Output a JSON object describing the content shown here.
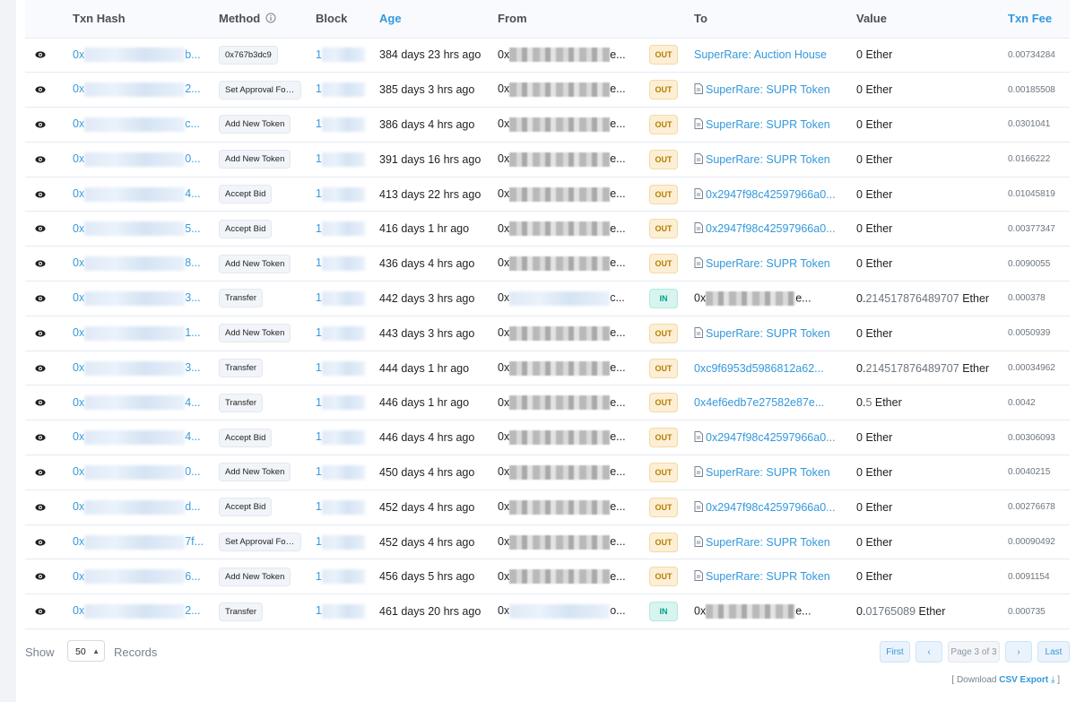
{
  "columns": {
    "eye": "",
    "txn_hash": "Txn Hash",
    "method": "Method",
    "block": "Block",
    "age": "Age",
    "from": "From",
    "dir": "",
    "to": "To",
    "value": "Value",
    "fee": "Txn Fee"
  },
  "rows": [
    {
      "hash_pre": "0x",
      "hash_tail": "b...",
      "method": "0x767b3dc9",
      "block_pre": "1",
      "age": "384 days 23 hrs ago",
      "from_pre": "0x",
      "from_tail": "e...",
      "direction": "OUT",
      "to": "SuperRare: Auction House",
      "to_contract": false,
      "to_link": true,
      "value_int": "0",
      "value_dec": "",
      "value_unit": "Ether",
      "fee": "0.00734284"
    },
    {
      "hash_pre": "0x",
      "hash_tail": "2...",
      "method": "Set Approval For...",
      "block_pre": "1",
      "age": "385 days 3 hrs ago",
      "from_pre": "0x",
      "from_tail": "e...",
      "direction": "OUT",
      "to": "SuperRare: SUPR Token",
      "to_contract": true,
      "to_link": true,
      "value_int": "0",
      "value_dec": "",
      "value_unit": "Ether",
      "fee": "0.00185508"
    },
    {
      "hash_pre": "0x",
      "hash_tail": "c...",
      "method": "Add New Token",
      "block_pre": "1",
      "age": "386 days 4 hrs ago",
      "from_pre": "0x",
      "from_tail": "e...",
      "direction": "OUT",
      "to": "SuperRare: SUPR Token",
      "to_contract": true,
      "to_link": true,
      "value_int": "0",
      "value_dec": "",
      "value_unit": "Ether",
      "fee": "0.0301041"
    },
    {
      "hash_pre": "0x",
      "hash_tail": "0...",
      "method": "Add New Token",
      "block_pre": "1",
      "age": "391 days 16 hrs ago",
      "from_pre": "0x",
      "from_tail": "e...",
      "direction": "OUT",
      "to": "SuperRare: SUPR Token",
      "to_contract": true,
      "to_link": true,
      "value_int": "0",
      "value_dec": "",
      "value_unit": "Ether",
      "fee": "0.0166222"
    },
    {
      "hash_pre": "0x",
      "hash_tail": "4...",
      "method": "Accept Bid",
      "block_pre": "1",
      "age": "413 days 22 hrs ago",
      "from_pre": "0x",
      "from_tail": "e...",
      "direction": "OUT",
      "to": "0x2947f98c42597966a0...",
      "to_contract": true,
      "to_link": true,
      "value_int": "0",
      "value_dec": "",
      "value_unit": "Ether",
      "fee": "0.01045819"
    },
    {
      "hash_pre": "0x",
      "hash_tail": "5...",
      "method": "Accept Bid",
      "block_pre": "1",
      "age": "416 days 1 hr ago",
      "from_pre": "0x",
      "from_tail": "e...",
      "direction": "OUT",
      "to": "0x2947f98c42597966a0...",
      "to_contract": true,
      "to_link": true,
      "value_int": "0",
      "value_dec": "",
      "value_unit": "Ether",
      "fee": "0.00377347"
    },
    {
      "hash_pre": "0x",
      "hash_tail": "8...",
      "method": "Add New Token",
      "block_pre": "1",
      "age": "436 days 4 hrs ago",
      "from_pre": "0x",
      "from_tail": "e...",
      "direction": "OUT",
      "to": "SuperRare: SUPR Token",
      "to_contract": true,
      "to_link": true,
      "value_int": "0",
      "value_dec": "",
      "value_unit": "Ether",
      "fee": "0.0090055"
    },
    {
      "hash_pre": "0x",
      "hash_tail": "3...",
      "method": "Transfer",
      "block_pre": "1",
      "age": "442 days 3 hrs ago",
      "from_pre": "0x",
      "from_tail": "c...",
      "from_link": true,
      "direction": "IN",
      "to": "0x",
      "to_tail": "e...",
      "to_contract": false,
      "to_link": false,
      "value_int": "0.",
      "value_dec": "214517876489707",
      "value_unit": "Ether",
      "fee": "0.000378"
    },
    {
      "hash_pre": "0x",
      "hash_tail": "1...",
      "method": "Add New Token",
      "block_pre": "1",
      "age": "443 days 3 hrs ago",
      "from_pre": "0x",
      "from_tail": "e...",
      "direction": "OUT",
      "to": "SuperRare: SUPR Token",
      "to_contract": true,
      "to_link": true,
      "value_int": "0",
      "value_dec": "",
      "value_unit": "Ether",
      "fee": "0.0050939"
    },
    {
      "hash_pre": "0x",
      "hash_tail": "3...",
      "method": "Transfer",
      "block_pre": "1",
      "age": "444 days 1 hr ago",
      "from_pre": "0x",
      "from_tail": "e...",
      "direction": "OUT",
      "to": "0xc9f6953d5986812a62...",
      "to_contract": false,
      "to_link": true,
      "value_int": "0.",
      "value_dec": "214517876489707",
      "value_unit": "Ether",
      "fee": "0.00034962"
    },
    {
      "hash_pre": "0x",
      "hash_tail": "4...",
      "method": "Transfer",
      "block_pre": "1",
      "age": "446 days 1 hr ago",
      "from_pre": "0x",
      "from_tail": "e...",
      "direction": "OUT",
      "to": "0x4ef6edb7e27582e87e...",
      "to_contract": false,
      "to_link": true,
      "value_int": "0.",
      "value_dec": "5",
      "value_unit": "Ether",
      "fee": "0.0042"
    },
    {
      "hash_pre": "0x",
      "hash_tail": "4...",
      "method": "Accept Bid",
      "block_pre": "1",
      "age": "446 days 4 hrs ago",
      "from_pre": "0x",
      "from_tail": "e...",
      "direction": "OUT",
      "to": "0x2947f98c42597966a0...",
      "to_contract": true,
      "to_link": true,
      "value_int": "0",
      "value_dec": "",
      "value_unit": "Ether",
      "fee": "0.00306093"
    },
    {
      "hash_pre": "0x",
      "hash_tail": "0...",
      "method": "Add New Token",
      "block_pre": "1",
      "age": "450 days 4 hrs ago",
      "from_pre": "0x",
      "from_tail": "e...",
      "direction": "OUT",
      "to": "SuperRare: SUPR Token",
      "to_contract": true,
      "to_link": true,
      "value_int": "0",
      "value_dec": "",
      "value_unit": "Ether",
      "fee": "0.0040215"
    },
    {
      "hash_pre": "0x",
      "hash_tail": "d...",
      "method": "Accept Bid",
      "block_pre": "1",
      "age": "452 days 4 hrs ago",
      "from_pre": "0x",
      "from_tail": "e...",
      "direction": "OUT",
      "to": "0x2947f98c42597966a0...",
      "to_contract": true,
      "to_link": true,
      "value_int": "0",
      "value_dec": "",
      "value_unit": "Ether",
      "fee": "0.00276678"
    },
    {
      "hash_pre": "0x",
      "hash_tail": "7f...",
      "method": "Set Approval For...",
      "block_pre": "1",
      "age": "452 days 4 hrs ago",
      "from_pre": "0x",
      "from_tail": "e...",
      "direction": "OUT",
      "to": "SuperRare: SUPR Token",
      "to_contract": true,
      "to_link": true,
      "value_int": "0",
      "value_dec": "",
      "value_unit": "Ether",
      "fee": "0.00090492"
    },
    {
      "hash_pre": "0x",
      "hash_tail": "6...",
      "method": "Add New Token",
      "block_pre": "1",
      "age": "456 days 5 hrs ago",
      "from_pre": "0x",
      "from_tail": "e...",
      "direction": "OUT",
      "to": "SuperRare: SUPR Token",
      "to_contract": true,
      "to_link": true,
      "value_int": "0",
      "value_dec": "",
      "value_unit": "Ether",
      "fee": "0.0091154"
    },
    {
      "hash_pre": "0x",
      "hash_tail": "2...",
      "method": "Transfer",
      "block_pre": "1",
      "age": "461 days 20 hrs ago",
      "from_pre": "0x",
      "from_tail": "o...",
      "from_link": true,
      "direction": "IN",
      "to": "0x",
      "to_tail": "e...",
      "to_contract": false,
      "to_link": false,
      "value_int": "0.",
      "value_dec": "01765089",
      "value_unit": "Ether",
      "fee": "0.000735"
    }
  ],
  "footer": {
    "show_label": "Show",
    "records_value": "50",
    "records_label": "Records",
    "first": "First",
    "page_info": "Page 3 of 3",
    "last": "Last",
    "csv_prefix": "[ Download",
    "csv_link": "CSV Export",
    "csv_suffix": "]"
  },
  "colors": {
    "link": "#3498db",
    "out_badge_bg": "#fcefd5",
    "in_badge_bg": "#d7f4ee"
  },
  "icons": {
    "view": "eye-icon",
    "method_info": "info-circle-icon",
    "contract": "document-icon",
    "prev": "chevron-left-icon",
    "next": "chevron-right-icon",
    "download": "download-icon"
  }
}
